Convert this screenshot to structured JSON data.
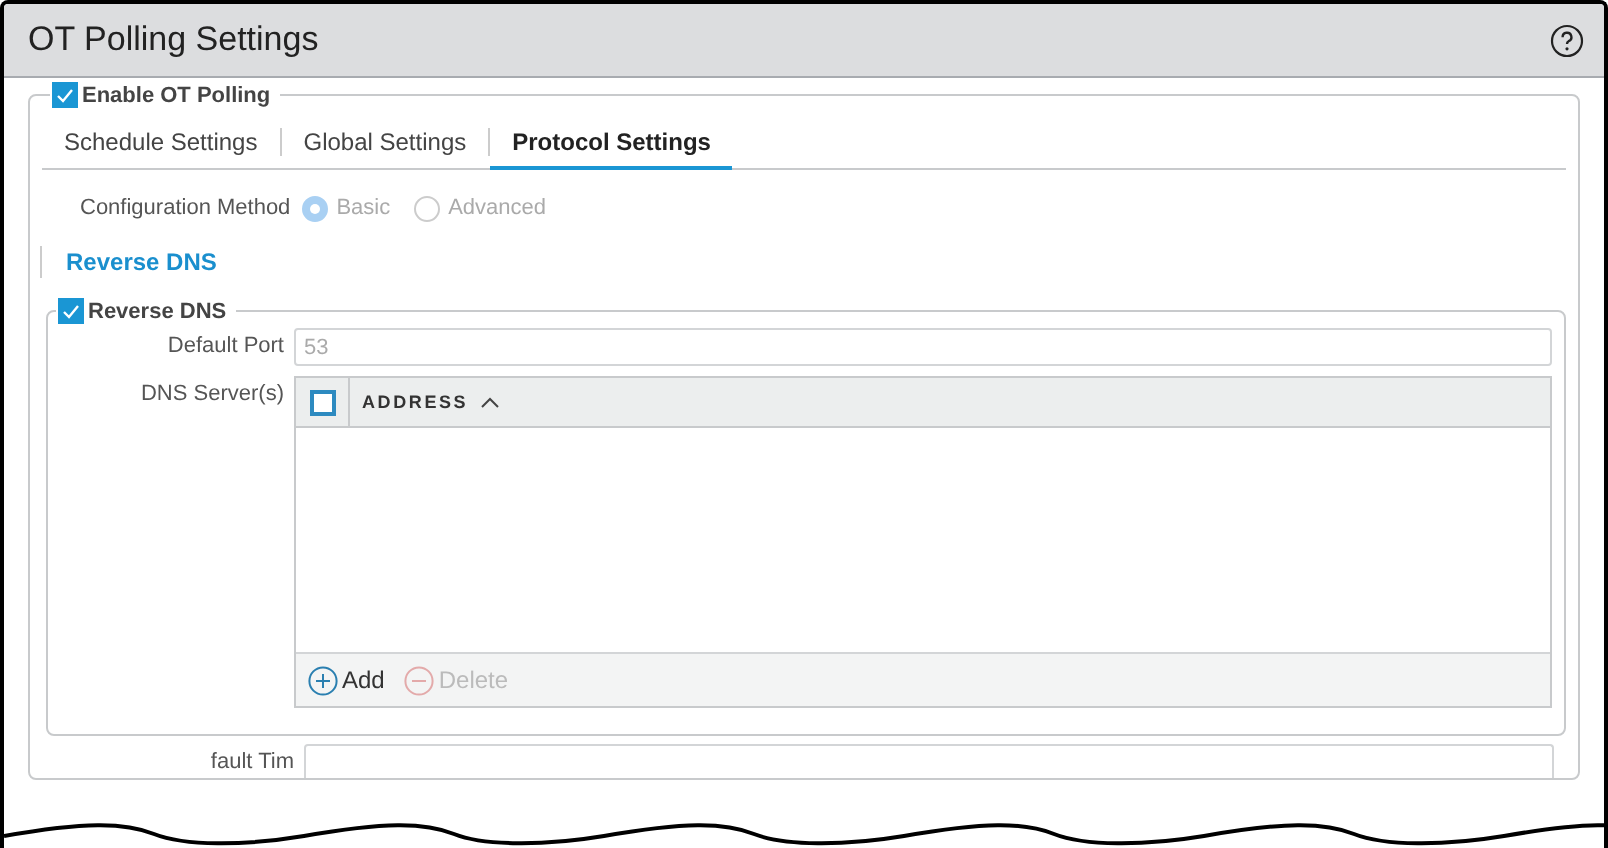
{
  "dialog": {
    "title": "OT Polling Settings"
  },
  "enable_ot_polling": {
    "label": "Enable OT Polling",
    "checked": true
  },
  "tabs": [
    {
      "label": "Schedule Settings",
      "selected": false
    },
    {
      "label": "Global Settings",
      "selected": false
    },
    {
      "label": "Protocol Settings",
      "selected": true
    }
  ],
  "configuration_method": {
    "label": "Configuration Method",
    "options": [
      {
        "label": "Basic",
        "selected": true,
        "disabled": true
      },
      {
        "label": "Advanced",
        "selected": false,
        "disabled": true
      }
    ]
  },
  "section_title": "Reverse DNS",
  "reverse_dns": {
    "label": "Reverse DNS",
    "checked": true,
    "default_port": {
      "label": "Default Port",
      "placeholder": "53"
    },
    "dns_servers": {
      "label": "DNS Server(s)",
      "select_all_checked": false,
      "columns": [
        "ADDRESS"
      ],
      "actions": [
        {
          "label": "Add",
          "kind": "add",
          "disabled": false
        },
        {
          "label": "Delete",
          "kind": "delete",
          "disabled": true
        }
      ]
    }
  },
  "next_field": {
    "label": "fault Tim"
  }
}
